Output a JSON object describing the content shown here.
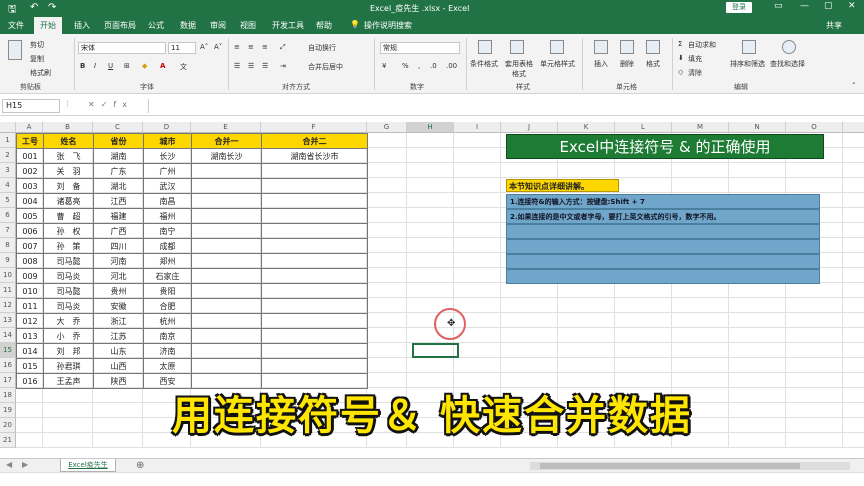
{
  "titlebar": {
    "save_icon": "save-icon",
    "undo_icon": "undo-icon",
    "redo_icon": "redo-icon",
    "title": "Excel_疫先生 .xlsx  -  Excel",
    "login": "登录"
  },
  "tabs": [
    "文件",
    "开始",
    "插入",
    "页面布局",
    "公式",
    "数据",
    "审阅",
    "视图",
    "开发工具",
    "帮助",
    "操作说明搜索"
  ],
  "share_label": "共享",
  "ribbon": {
    "clipboard": {
      "cut": "剪切",
      "copy": "复制",
      "painter": "格式刷",
      "label": "剪贴板"
    },
    "font": {
      "name": "宋体",
      "size": "11",
      "label": "字体",
      "bold": "B",
      "italic": "I",
      "underline": "U"
    },
    "alignment": {
      "wrap": "自动换行",
      "merge": "合并后居中",
      "label": "对齐方式"
    },
    "number": {
      "format": "常规",
      "label": "数字"
    },
    "styles": {
      "cond": "条件格式",
      "table": "套用表格格式",
      "cell": "单元格样式",
      "label": "样式"
    },
    "cells": {
      "insert": "插入",
      "delete": "删除",
      "format": "格式",
      "label": "单元格"
    },
    "editing": {
      "sum": "自动求和",
      "fill": "填充",
      "clear": "清除",
      "sort": "排序和筛选",
      "find": "查找和选择",
      "label": "编辑"
    }
  },
  "formula_bar": {
    "cell_ref": "H15",
    "fx": "fx",
    "content": ""
  },
  "columns": [
    "A",
    "B",
    "C",
    "D",
    "E",
    "F",
    "G",
    "H",
    "I",
    "J",
    "K",
    "L",
    "M",
    "N",
    "O",
    "P"
  ],
  "rows": [
    "1",
    "2",
    "3",
    "4",
    "5",
    "6",
    "7",
    "8",
    "9",
    "10",
    "11",
    "12",
    "13",
    "14",
    "15",
    "16",
    "17",
    "18",
    "19",
    "20",
    "21"
  ],
  "table": {
    "headers": [
      "工号",
      "姓名",
      "省份",
      "城市",
      "合并一",
      "合并二"
    ],
    "rows": [
      [
        "001",
        "张　飞",
        "湖南",
        "长沙",
        "湖南长沙",
        "湖南省长沙市"
      ],
      [
        "002",
        "关　羽",
        "广东",
        "广州",
        "",
        ""
      ],
      [
        "003",
        "刘　备",
        "湖北",
        "武汉",
        "",
        ""
      ],
      [
        "004",
        "诸葛亮",
        "江西",
        "南昌",
        "",
        ""
      ],
      [
        "005",
        "曹　超",
        "福建",
        "福州",
        "",
        ""
      ],
      [
        "006",
        "孙　权",
        "广西",
        "南宁",
        "",
        ""
      ],
      [
        "007",
        "孙　策",
        "四川",
        "成都",
        "",
        ""
      ],
      [
        "008",
        "司马懿",
        "河南",
        "郑州",
        "",
        ""
      ],
      [
        "009",
        "司马炎",
        "河北",
        "石家庄",
        "",
        ""
      ],
      [
        "010",
        "司马懿",
        "贵州",
        "贵阳",
        "",
        ""
      ],
      [
        "011",
        "司马炎",
        "安徽",
        "合肥",
        "",
        ""
      ],
      [
        "012",
        "大　乔",
        "浙江",
        "杭州",
        "",
        ""
      ],
      [
        "013",
        "小　乔",
        "江苏",
        "南京",
        "",
        ""
      ],
      [
        "014",
        "刘　邦",
        "山东",
        "济南",
        "",
        ""
      ],
      [
        "015",
        "孙君琪",
        "山西",
        "太原",
        "",
        ""
      ],
      [
        "016",
        "王孟声",
        "陕西",
        "西安",
        "",
        ""
      ]
    ]
  },
  "banner": "Excel中连接符号 & 的正确使用",
  "notes_heading": "本节知识点详细讲解。",
  "notes": [
    "1.连接符&的输入方式：按键盘:Shift + 7",
    "2.如果连接的是中文或者字母，要打上英文格式的引号，数字不用。",
    "",
    "",
    "",
    ""
  ],
  "overlay_caption": "用连接符号＆ 快速合并数据",
  "sheet_tab": "Excel疫先生",
  "colors": {
    "excel_green": "#217346",
    "header_yellow": "#ffd700",
    "banner_green": "#1e7b34",
    "note_blue": "#6fa6c9",
    "caption_yellow": "#ffe600"
  }
}
